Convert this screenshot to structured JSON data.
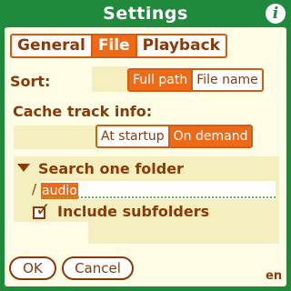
{
  "window": {
    "title": "Settings",
    "info_icon": "info-icon"
  },
  "tabs": [
    {
      "label": "General",
      "selected": false
    },
    {
      "label": "File",
      "selected": true
    },
    {
      "label": "Playback",
      "selected": false
    }
  ],
  "sort": {
    "label": "Sort:",
    "options": [
      {
        "label": "Full path",
        "selected": true
      },
      {
        "label": "File name",
        "selected": false
      }
    ]
  },
  "cache": {
    "label": "Cache track info:",
    "options": [
      {
        "label": "At startup",
        "selected": false
      },
      {
        "label": "On demand",
        "selected": true
      }
    ]
  },
  "search": {
    "trigger_label": "Search one folder",
    "trigger_icon": "triangle-down-icon",
    "path_prefix": "/",
    "folder": "audio",
    "include_subfolders_label": "Include subfolders",
    "include_subfolders_checked": true
  },
  "buttons": {
    "ok": "OK",
    "cancel": "Cancel"
  },
  "locale": "en",
  "colors": {
    "frame": "#1f8a3c",
    "accent": "#ed6b17",
    "text": "#8a3a08",
    "background": "#fffde6"
  }
}
